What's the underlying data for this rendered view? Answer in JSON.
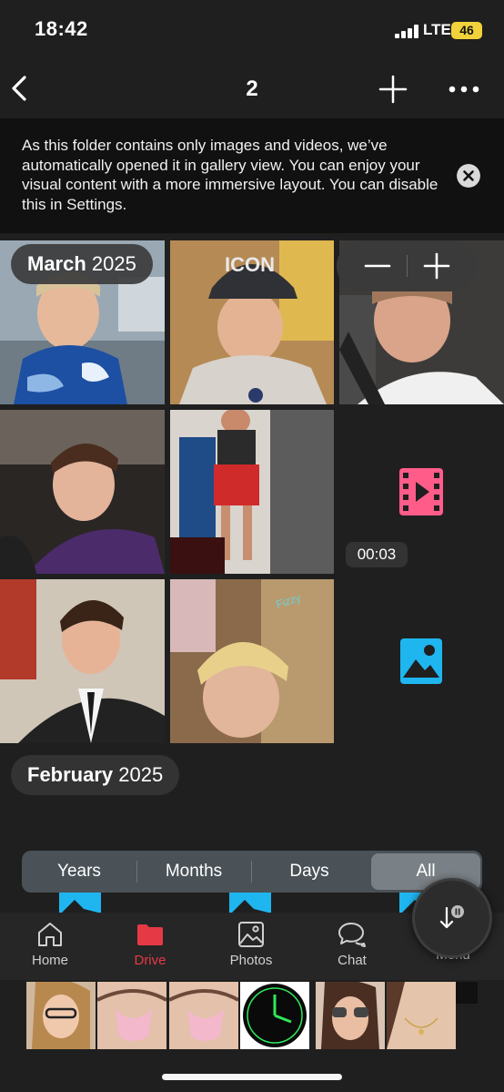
{
  "status": {
    "time": "18:42",
    "network": "LTE",
    "battery": "46"
  },
  "nav": {
    "title": "2"
  },
  "banner": {
    "text": "As this folder contains only images and videos, we’ve automatically opened it in gallery view. You can enjoy your visual content with a more immersive layout. You can disable this in Settings."
  },
  "sections": [
    {
      "month": "March",
      "year": "2025"
    },
    {
      "month": "February",
      "year": "2025"
    }
  ],
  "video": {
    "duration": "00:03"
  },
  "view_modes": {
    "years": "Years",
    "months": "Months",
    "days": "Days",
    "all": "All",
    "selected": "All"
  },
  "tabs": {
    "home": "Home",
    "drive": "Drive",
    "photos": "Photos",
    "chat": "Chat",
    "menu": "Menu",
    "active": "Drive"
  },
  "colors": {
    "accent": "#e63946",
    "video_icon": "#ff5c8a",
    "image_icon": "#1fb6f0"
  }
}
